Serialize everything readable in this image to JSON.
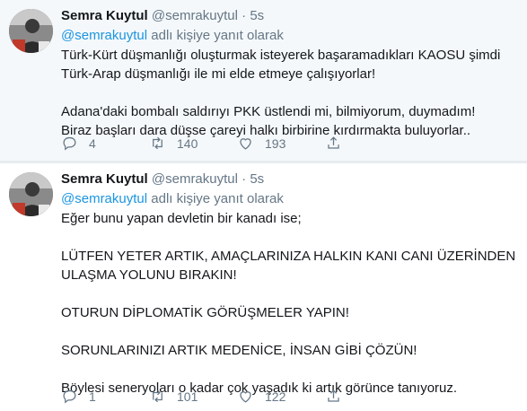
{
  "tweets": [
    {
      "author_name": "Semra Kuytul",
      "handle": "@semrakuytul",
      "separator": "·",
      "time": "5s",
      "reply_mention": "@semrakuytul",
      "reply_suffix": " adlı kişiye yanıt olarak",
      "lines": [
        "Türk-Kürt düşmanlığı oluşturmak isteyerek başaramadıkları KAOSU şimdi",
        "Türk-Arap düşmanlığı ile mi elde etmeye çalışıyorlar!",
        "",
        "Adana'daki bombalı saldırıyı PKK üstlendi mi, bilmiyorum, duymadım!",
        "Biraz başları dara düşse çareyi halkı birbirine kırdırmakta buluyorlar.."
      ],
      "replies": "4",
      "retweets": "140",
      "likes": "193"
    },
    {
      "author_name": "Semra Kuytul",
      "handle": "@semrakuytul",
      "separator": "·",
      "time": "5s",
      "reply_mention": "@semrakuytul",
      "reply_suffix": " adlı kişiye yanıt olarak",
      "lines": [
        "Eğer bunu yapan devletin bir kanadı ise;",
        "",
        "LÜTFEN YETER ARTIK, AMAÇLARINIZA HALKIN KANI CANI ÜZERİNDEN",
        "ULAŞMA YOLUNU BIRAKIN!",
        "",
        "OTURUN DİPLOMATİK GÖRÜŞMELER YAPIN!",
        "",
        "SORUNLARINIZI ARTIK MEDENİCE, İNSAN GİBİ ÇÖZÜN!",
        "",
        "Böylesi seneryoları o kadar çok yaşadık ki artık görünce tanıyoruz."
      ],
      "replies": "1",
      "retweets": "101",
      "likes": "122"
    }
  ],
  "icons": {
    "reply": "reply-icon",
    "retweet": "retweet-icon",
    "like": "heart-icon",
    "share": "share-icon"
  },
  "colors": {
    "mention": "#1b95e0",
    "muted": "#657786",
    "text": "#14171a",
    "highlight_bg": "#f5f8fa"
  }
}
